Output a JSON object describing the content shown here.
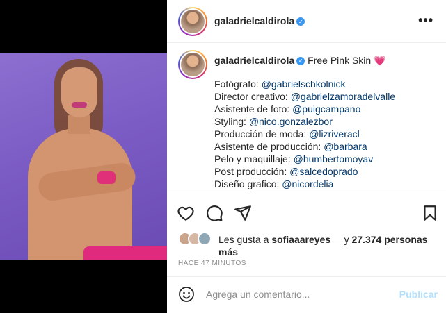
{
  "post": {
    "username": "galadrielcaldirola",
    "caption": "Free Pink Skin 💗",
    "credits": [
      {
        "role": "Fotógrafo:",
        "handle": "@gabrielschkolnick"
      },
      {
        "role": "Director creativo:",
        "handle": "@gabrielzamoradelvalle"
      },
      {
        "role": "Asistente de foto:",
        "handle": "@puigcampano"
      },
      {
        "role": "Styling:",
        "handle": "@nico.gonzalezbor"
      },
      {
        "role": "Producción de moda:",
        "handle": "@lizriveracl"
      },
      {
        "role": "Asistente de producción:",
        "handle": "@barbara"
      },
      {
        "role": "Pelo y maquillaje:",
        "handle": "@humbertomoyav"
      },
      {
        "role": "Post producción:",
        "handle": "@salcedoprado"
      },
      {
        "role": "Diseño grafico:",
        "handle": "@nicordelia"
      }
    ],
    "likes_prefix": "Les gusta a",
    "likes_user": "sofiaaareyes__",
    "likes_connector": "y",
    "likes_count": "27.374 personas más",
    "timestamp": "HACE 47 MINUTOS",
    "more_label": "•••"
  },
  "comment": {
    "placeholder": "Agrega un comentario...",
    "post_label": "Publicar"
  },
  "colors": {
    "link": "#00376b",
    "verified": "#3897f0",
    "post_button_disabled": "#b2dffc"
  },
  "icons": [
    "heart-icon",
    "comment-icon",
    "share-icon",
    "bookmark-icon",
    "emoji-icon",
    "more-icon",
    "verified-icon"
  ]
}
